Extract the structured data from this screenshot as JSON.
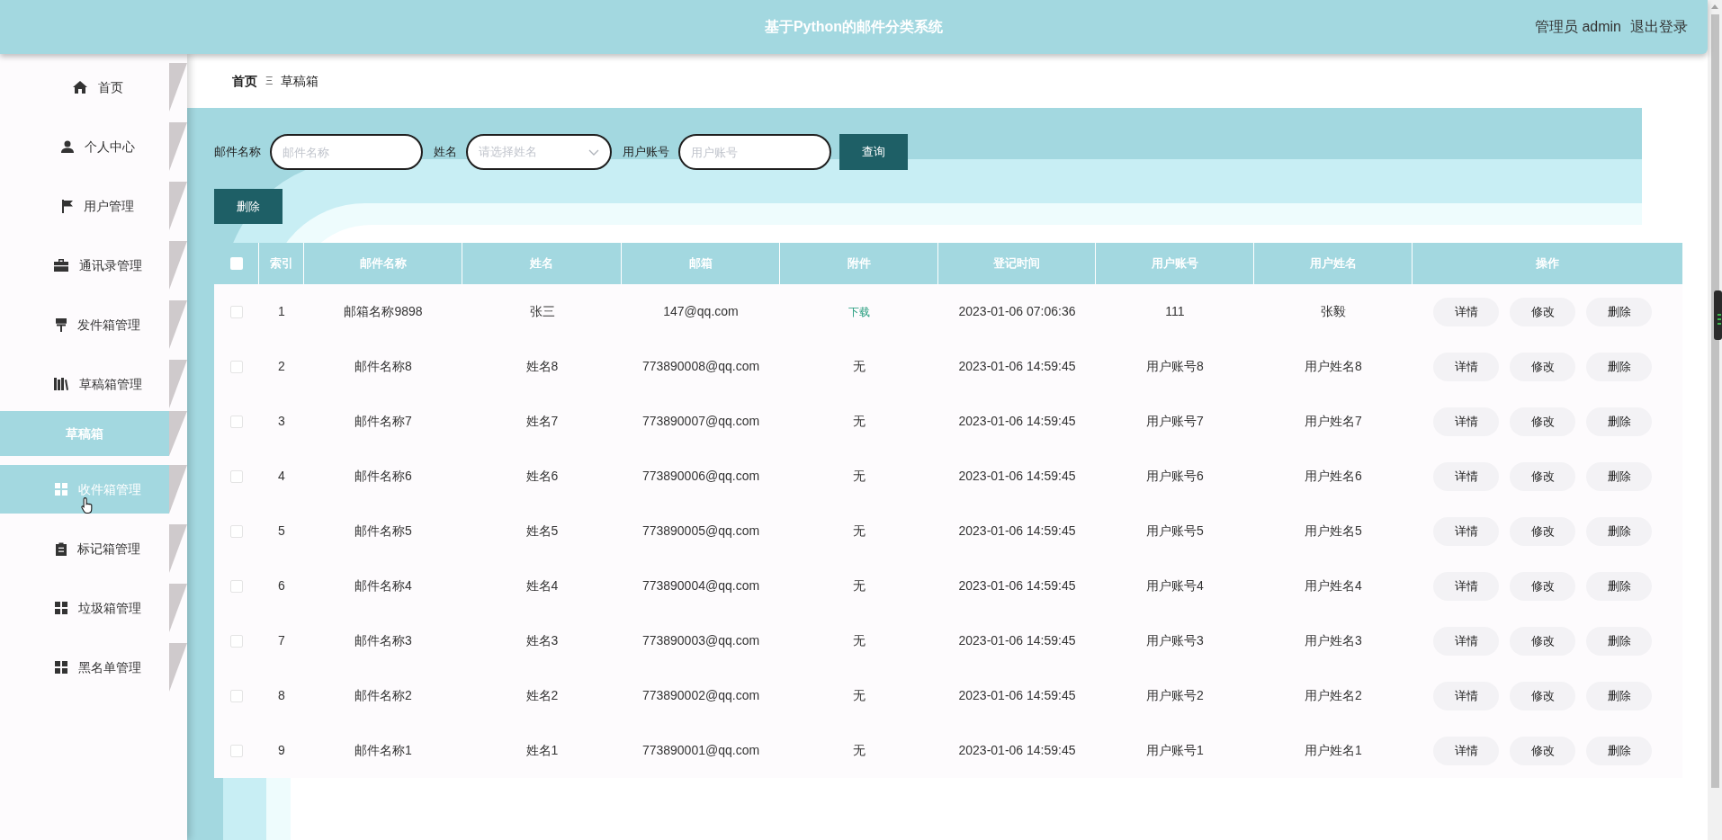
{
  "header": {
    "title": "基于Python的邮件分类系统",
    "user": "管理员 admin",
    "logout": "退出登录"
  },
  "sidebar": {
    "items": [
      {
        "label": "首页",
        "selected": false,
        "hovered": false
      },
      {
        "label": "个人中心",
        "selected": false,
        "hovered": false
      },
      {
        "label": "用户管理",
        "selected": false,
        "hovered": false
      },
      {
        "label": "通讯录管理",
        "selected": false,
        "hovered": false
      },
      {
        "label": "发件箱管理",
        "selected": false,
        "hovered": false
      },
      {
        "label": "草稿箱管理",
        "selected": false,
        "hovered": false,
        "children": [
          {
            "label": "草稿箱",
            "selected": true
          }
        ]
      },
      {
        "label": "收件箱管理",
        "selected": false,
        "hovered": true
      },
      {
        "label": "标记箱管理",
        "selected": false,
        "hovered": false
      },
      {
        "label": "垃圾箱管理",
        "selected": false,
        "hovered": false
      },
      {
        "label": "黑名单管理",
        "selected": false,
        "hovered": false
      }
    ]
  },
  "breadcrumb": {
    "items": [
      "首页",
      "草稿箱"
    ],
    "separator": "Ξ"
  },
  "search": {
    "fields": [
      {
        "kind": "input",
        "label": "邮件名称",
        "placeholder": "邮件名称"
      },
      {
        "kind": "select",
        "label": "姓名",
        "placeholder": "请选择姓名"
      },
      {
        "kind": "input",
        "label": "用户账号",
        "placeholder": "用户账号"
      }
    ],
    "button": "查询"
  },
  "toolbar": {
    "delete_button": "删除"
  },
  "table": {
    "header_checked": false,
    "columns": [
      "索引",
      "邮件名称",
      "姓名",
      "邮箱",
      "附件",
      "登记时间",
      "用户账号",
      "用户姓名",
      "操作"
    ],
    "rows": [
      {
        "checked": false,
        "index": "1",
        "mail_name": "邮箱名称9898",
        "name": "张三",
        "email": "147@qq.com",
        "attachment": {
          "kind": "link",
          "text": "下载"
        },
        "time": "2023-01-06 07:06:36",
        "account": "111",
        "user_name": "张毅",
        "actions": [
          "详情",
          "修改",
          "删除"
        ]
      },
      {
        "checked": false,
        "index": "2",
        "mail_name": "邮件名称8",
        "name": "姓名8",
        "email": "773890008@qq.com",
        "attachment": {
          "kind": "text",
          "text": "无"
        },
        "time": "2023-01-06 14:59:45",
        "account": "用户账号8",
        "user_name": "用户姓名8",
        "actions": [
          "详情",
          "修改",
          "删除"
        ]
      },
      {
        "checked": false,
        "index": "3",
        "mail_name": "邮件名称7",
        "name": "姓名7",
        "email": "773890007@qq.com",
        "attachment": {
          "kind": "text",
          "text": "无"
        },
        "time": "2023-01-06 14:59:45",
        "account": "用户账号7",
        "user_name": "用户姓名7",
        "actions": [
          "详情",
          "修改",
          "删除"
        ]
      },
      {
        "checked": false,
        "index": "4",
        "mail_name": "邮件名称6",
        "name": "姓名6",
        "email": "773890006@qq.com",
        "attachment": {
          "kind": "text",
          "text": "无"
        },
        "time": "2023-01-06 14:59:45",
        "account": "用户账号6",
        "user_name": "用户姓名6",
        "actions": [
          "详情",
          "修改",
          "删除"
        ]
      },
      {
        "checked": false,
        "index": "5",
        "mail_name": "邮件名称5",
        "name": "姓名5",
        "email": "773890005@qq.com",
        "attachment": {
          "kind": "text",
          "text": "无"
        },
        "time": "2023-01-06 14:59:45",
        "account": "用户账号5",
        "user_name": "用户姓名5",
        "actions": [
          "详情",
          "修改",
          "删除"
        ]
      },
      {
        "checked": false,
        "index": "6",
        "mail_name": "邮件名称4",
        "name": "姓名4",
        "email": "773890004@qq.com",
        "attachment": {
          "kind": "text",
          "text": "无"
        },
        "time": "2023-01-06 14:59:45",
        "account": "用户账号4",
        "user_name": "用户姓名4",
        "actions": [
          "详情",
          "修改",
          "删除"
        ]
      },
      {
        "checked": false,
        "index": "7",
        "mail_name": "邮件名称3",
        "name": "姓名3",
        "email": "773890003@qq.com",
        "attachment": {
          "kind": "text",
          "text": "无"
        },
        "time": "2023-01-06 14:59:45",
        "account": "用户账号3",
        "user_name": "用户姓名3",
        "actions": [
          "详情",
          "修改",
          "删除"
        ]
      },
      {
        "checked": false,
        "index": "8",
        "mail_name": "邮件名称2",
        "name": "姓名2",
        "email": "773890002@qq.com",
        "attachment": {
          "kind": "text",
          "text": "无"
        },
        "time": "2023-01-06 14:59:45",
        "account": "用户账号2",
        "user_name": "用户姓名2",
        "actions": [
          "详情",
          "修改",
          "删除"
        ]
      },
      {
        "checked": false,
        "index": "9",
        "mail_name": "邮件名称1",
        "name": "姓名1",
        "email": "773890001@qq.com",
        "attachment": {
          "kind": "text",
          "text": "无"
        },
        "time": "2023-01-06 14:59:45",
        "account": "用户账号1",
        "user_name": "用户姓名1",
        "actions": [
          "详情",
          "修改",
          "删除"
        ]
      }
    ]
  }
}
